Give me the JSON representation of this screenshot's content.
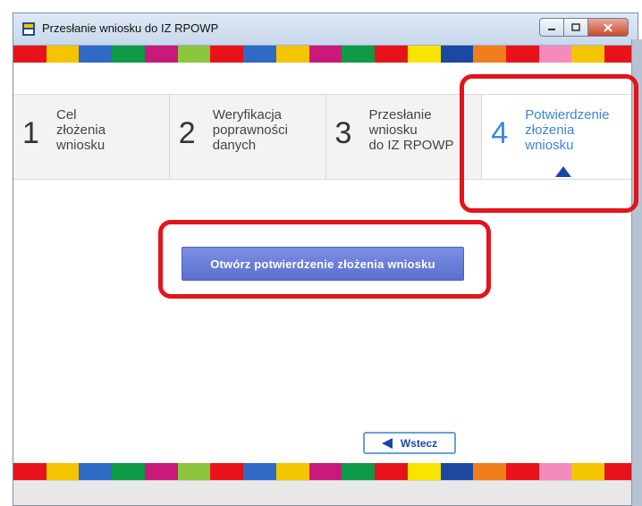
{
  "window": {
    "title": "Przesłanie wniosku do IZ RPOWP"
  },
  "colors": {
    "stripe": [
      "#e8131a",
      "#f5c400",
      "#2f6bc5",
      "#0f9a48",
      "#c9197b",
      "#8cc63e",
      "#e8131a",
      "#2f6bc5",
      "#f5c400",
      "#c9197b",
      "#0f9a48",
      "#e8131a",
      "#f9e400",
      "#1b48a0",
      "#f07e1a",
      "#e8131a",
      "#f58bbd",
      "#f5c400",
      "#e8131a"
    ],
    "active_step": "#3b86d6",
    "highlight": "#e3141b"
  },
  "steps": [
    {
      "number": "1",
      "label": "Cel\nzłożenia\nwniosku",
      "active": false
    },
    {
      "number": "2",
      "label": "Weryfikacja\npoprawności\ndanych",
      "active": false
    },
    {
      "number": "3",
      "label": "Przesłanie\nwniosku\ndo IZ RPOWP",
      "active": false
    },
    {
      "number": "4",
      "label": "Potwierdzenie\nzłożenia\nwniosku",
      "active": true
    }
  ],
  "actions": {
    "open_confirmation": "Otwórz potwierdzenie złożenia wniosku",
    "back": "Wstecz"
  },
  "icons": {
    "app": "app-icon",
    "minimize": "minimize-icon",
    "maximize": "maximize-icon",
    "close": "close-icon",
    "back": "back-arrow-icon",
    "active_marker": "triangle-up-icon"
  }
}
